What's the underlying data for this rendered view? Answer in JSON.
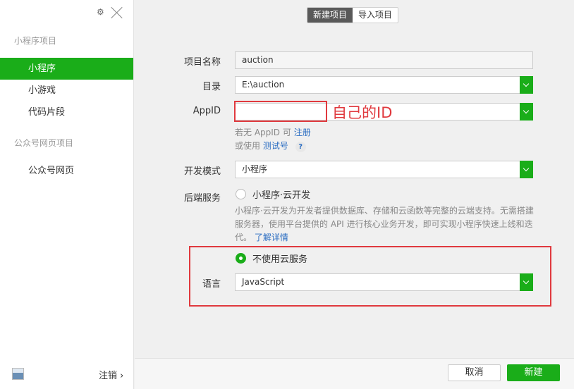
{
  "sidebar": {
    "gear_glyph": "⚙",
    "section_miniprogram": "小程序项目",
    "items_mini": [
      {
        "label": "小程序"
      },
      {
        "label": "小游戏"
      },
      {
        "label": "代码片段"
      }
    ],
    "section_official": "公众号网页项目",
    "items_official": [
      {
        "label": "公众号网页"
      }
    ],
    "logout_label": "注销 ›"
  },
  "tabs": {
    "new_project": "新建项目",
    "import_project": "导入项目"
  },
  "form": {
    "project_name_label": "项目名称",
    "project_name_value": "auction",
    "directory_label": "目录",
    "directory_value": "E:\\auction",
    "appid_label": "AppID",
    "appid_value": "",
    "appid_hint_prefix": "若无 AppID 可",
    "appid_register_link": "注册",
    "appid_hint2_prefix": "或使用",
    "test_account_link": "测试号",
    "help_glyph": "?",
    "dev_mode_label": "开发模式",
    "dev_mode_value": "小程序",
    "backend_label": "后端服务",
    "option_cloud": "小程序·云开发",
    "cloud_desc": "小程序·云开发为开发者提供数据库、存储和云函数等完整的云端支持。无需搭建服务器，使用平台提供的 API 进行核心业务开发，即可实现小程序快速上线和迭代。",
    "learn_more_link": "了解详情",
    "option_no_cloud": "不使用云服务",
    "language_label": "语言",
    "language_value": "JavaScript"
  },
  "annotation": {
    "appid_note": "自己的ID"
  },
  "footer": {
    "cancel_label": "取消",
    "create_label": "新建"
  },
  "colors": {
    "accent": "#1aad19",
    "annotation": "#e0393e"
  }
}
